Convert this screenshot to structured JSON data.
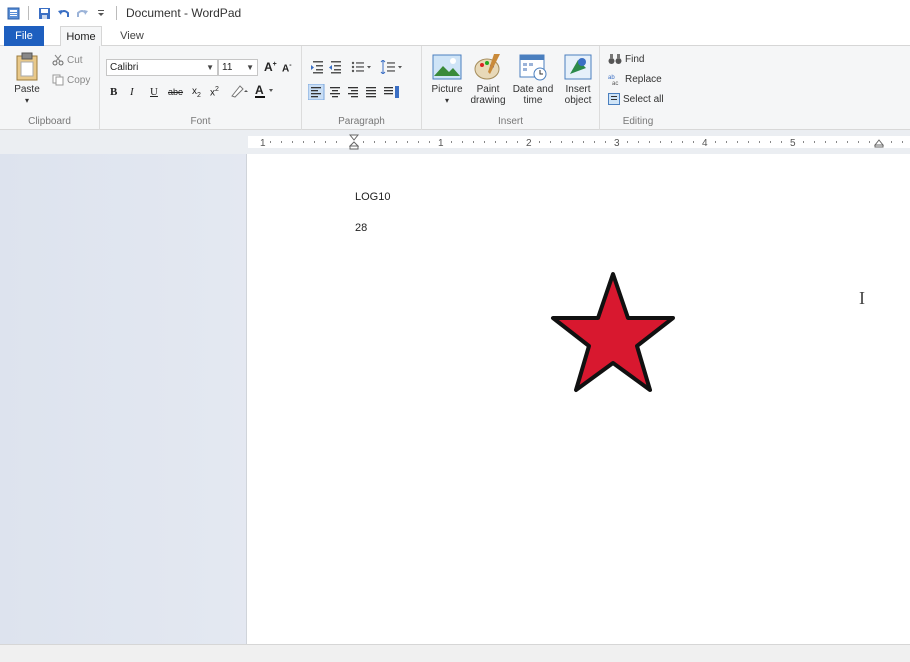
{
  "window": {
    "title": "Document - WordPad"
  },
  "tabs": [
    {
      "label": "File"
    },
    {
      "label": "Home"
    },
    {
      "label": "View"
    }
  ],
  "clipboard": {
    "paste": "Paste",
    "cut": "Cut",
    "copy": "Copy",
    "group_label": "Clipboard"
  },
  "font": {
    "family": "Calibri",
    "size": "11",
    "group_label": "Font"
  },
  "paragraph": {
    "group_label": "Paragraph"
  },
  "insert": {
    "picture": "Picture",
    "paint_line1": "Paint",
    "paint_line2": "drawing",
    "datetime_line1": "Date and",
    "datetime_line2": "time",
    "object_line1": "Insert",
    "object_line2": "object",
    "group_label": "Insert"
  },
  "editing": {
    "find": "Find",
    "replace": "Replace",
    "select_all": "Select all",
    "group_label": "Editing"
  },
  "ruler": {
    "marks": [
      "1",
      "1",
      "2",
      "3",
      "4",
      "5"
    ]
  },
  "document": {
    "lines": [
      "LOG10",
      "28"
    ],
    "star_color": "#d8182f"
  },
  "colors": {
    "accent": "#1e5fbf"
  }
}
